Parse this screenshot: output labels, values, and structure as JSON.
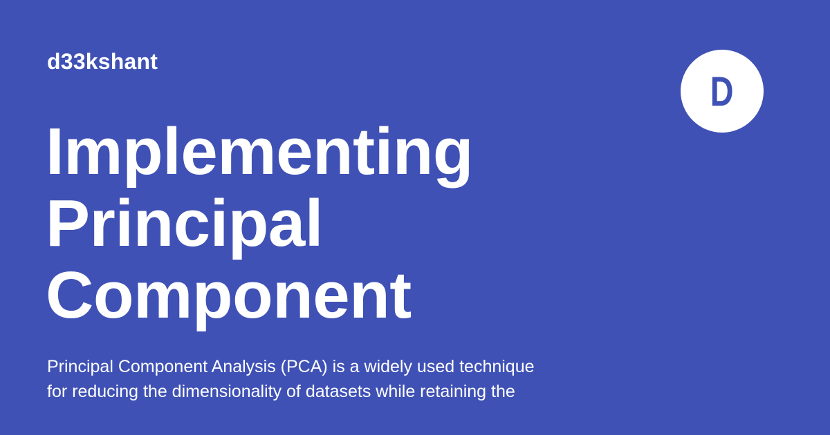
{
  "site": {
    "name": "d33kshant"
  },
  "logo": {
    "letter": "D",
    "background_color": "#ffffff",
    "letter_color": "#3f51b5"
  },
  "post": {
    "title_lines": [
      "Implementing",
      "Principal",
      "Component"
    ],
    "description_lines": [
      "Principal Component Analysis (PCA) is a widely used technique",
      "for reducing the dimensionality of datasets while retaining the"
    ]
  },
  "theme": {
    "background_color": "#3f51b5",
    "text_color": "#ffffff"
  }
}
